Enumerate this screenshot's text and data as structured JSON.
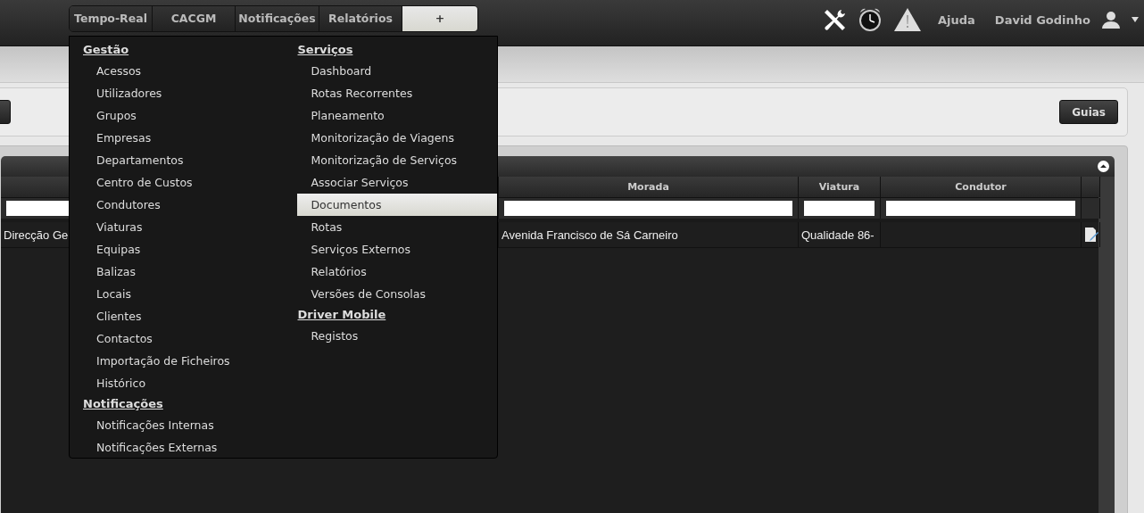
{
  "nav": {
    "tabs": [
      {
        "label": "Tempo-Real",
        "selected": false
      },
      {
        "label": "CACGM",
        "selected": false
      },
      {
        "label": "Notificações",
        "selected": false
      },
      {
        "label": "Relatórios",
        "selected": false
      },
      {
        "label": "+",
        "selected": true
      }
    ]
  },
  "header_right": {
    "help": "Ajuda",
    "user": "David Godinho"
  },
  "menu": {
    "columns": [
      [
        {
          "kind": "heading",
          "label": "Gestão"
        },
        {
          "kind": "item",
          "label": "Acessos",
          "selected": false
        },
        {
          "kind": "item",
          "label": "Utilizadores",
          "selected": false
        },
        {
          "kind": "item",
          "label": "Grupos",
          "selected": false
        },
        {
          "kind": "item",
          "label": "Empresas",
          "selected": false
        },
        {
          "kind": "item",
          "label": "Departamentos",
          "selected": false
        },
        {
          "kind": "item",
          "label": "Centro de Custos",
          "selected": false
        },
        {
          "kind": "item",
          "label": "Condutores",
          "selected": false
        },
        {
          "kind": "item",
          "label": "Viaturas",
          "selected": false
        },
        {
          "kind": "item",
          "label": "Equipas",
          "selected": false
        },
        {
          "kind": "item",
          "label": "Balizas",
          "selected": false
        },
        {
          "kind": "item",
          "label": "Locais",
          "selected": false
        },
        {
          "kind": "item",
          "label": "Clientes",
          "selected": false
        },
        {
          "kind": "item",
          "label": "Contactos",
          "selected": false
        },
        {
          "kind": "item",
          "label": "Importação de Ficheiros",
          "selected": false
        },
        {
          "kind": "item",
          "label": "Histórico",
          "selected": false
        },
        {
          "kind": "heading",
          "label": "Notificações"
        },
        {
          "kind": "item",
          "label": "Notificações Internas",
          "selected": false
        },
        {
          "kind": "item",
          "label": "Notificações Externas",
          "selected": false
        }
      ],
      [
        {
          "kind": "heading",
          "label": "Serviços"
        },
        {
          "kind": "item",
          "label": "Dashboard",
          "selected": false
        },
        {
          "kind": "item",
          "label": "Rotas Recorrentes",
          "selected": false
        },
        {
          "kind": "item",
          "label": "Planeamento",
          "selected": false
        },
        {
          "kind": "item",
          "label": "Monitorização de Viagens",
          "selected": false
        },
        {
          "kind": "item",
          "label": "Monitorização de Serviços",
          "selected": false
        },
        {
          "kind": "item",
          "label": "Associar Serviços",
          "selected": false
        },
        {
          "kind": "item",
          "label": "Documentos",
          "selected": true
        },
        {
          "kind": "item",
          "label": "Rotas",
          "selected": false
        },
        {
          "kind": "item",
          "label": "Serviços Externos",
          "selected": false
        },
        {
          "kind": "item",
          "label": "Relatórios",
          "selected": false
        },
        {
          "kind": "item",
          "label": "Versões de Consolas",
          "selected": false
        },
        {
          "kind": "heading",
          "label": "Driver Mobile"
        },
        {
          "kind": "item",
          "label": "Registos",
          "selected": false
        }
      ]
    ]
  },
  "toolbar": {
    "button": "Guias"
  },
  "grid": {
    "columns": [
      {},
      {},
      {
        "label": "Morada"
      },
      {
        "label": "Viatura"
      },
      {
        "label": "Condutor"
      }
    ],
    "rows": [
      {
        "cells": [
          {
            "text": "Direcção Ge"
          },
          {},
          {
            "text": "Avenida Francisco de Sá Carneiro"
          },
          {
            "text": "Qualidade 86-"
          },
          {}
        ]
      }
    ]
  }
}
